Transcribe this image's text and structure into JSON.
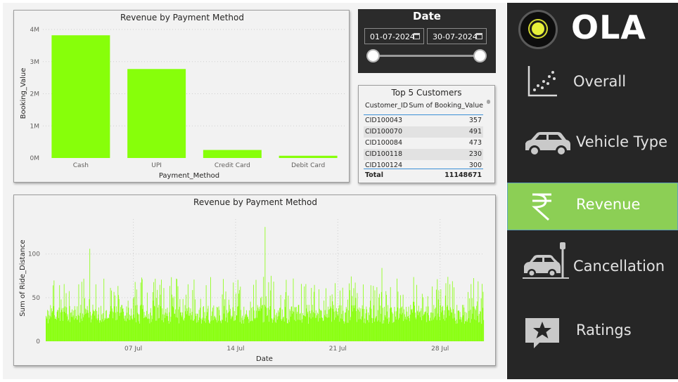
{
  "colors": {
    "bar": "#87ff0a",
    "sidebar_bg": "#262626",
    "active_nav": "#8ccf55",
    "slicer_bg": "#2b2b2b"
  },
  "date_slicer": {
    "title": "Date",
    "start": "01-07-2024",
    "end": "30-07-2024"
  },
  "top_customers": {
    "title": "Top 5 Customers",
    "headers": [
      "Customer_ID",
      "Sum of Booking_Value"
    ],
    "rows": [
      [
        "CID100043",
        "357"
      ],
      [
        "CID100070",
        "491"
      ],
      [
        "CID100084",
        "473"
      ],
      [
        "CID100118",
        "230"
      ],
      [
        "CID100124",
        "300"
      ]
    ],
    "total_label": "Total",
    "total_value": "11148671"
  },
  "sidebar": {
    "logo": "OLA",
    "items": [
      {
        "label": "Overall",
        "icon": "scatter-chart-icon",
        "active": false
      },
      {
        "label": "Vehicle Type",
        "icon": "car-icon",
        "active": false
      },
      {
        "label": "Revenue",
        "icon": "rupee-icon",
        "active": true
      },
      {
        "label": "Cancellation",
        "icon": "car-crash-icon",
        "active": false
      },
      {
        "label": "Ratings",
        "icon": "star-icon",
        "active": false
      }
    ]
  },
  "chart_data": [
    {
      "type": "bar",
      "title": "Revenue by Payment Method",
      "xlabel": "Payment_Method",
      "ylabel": "Booking_Value",
      "categories": [
        "Cash",
        "UPI",
        "Credit Card",
        "Debit Card"
      ],
      "values": [
        3820000,
        2770000,
        250000,
        70000
      ],
      "ylim": [
        0,
        4000000
      ],
      "y_ticks": [
        0,
        1000000,
        2000000,
        3000000,
        4000000
      ],
      "y_tick_labels": [
        "0M",
        "1M",
        "2M",
        "3M",
        "4M"
      ],
      "grid": true
    },
    {
      "type": "bar",
      "title": "Revenue by Payment Method",
      "xlabel": "Date",
      "ylabel": "Sum of Ride_Distance",
      "x_range": [
        "2024-07-01",
        "2024-07-31"
      ],
      "x_tick_labels": [
        "07 Jul",
        "14 Jul",
        "21 Jul",
        "28 Jul"
      ],
      "ylim": [
        0,
        140
      ],
      "y_ticks": [
        0,
        50,
        100
      ],
      "y_tick_labels": [
        "0",
        "50",
        "100"
      ],
      "note_values": "dense time series of ~870 bars, values mostly 20-65, peaks near 105-130",
      "peaks": [
        {
          "x": "2024-07-04",
          "y": 106
        },
        {
          "x": "2024-07-16",
          "y": 131
        },
        {
          "x": "2024-07-24",
          "y": 84
        }
      ],
      "grid": true
    }
  ]
}
